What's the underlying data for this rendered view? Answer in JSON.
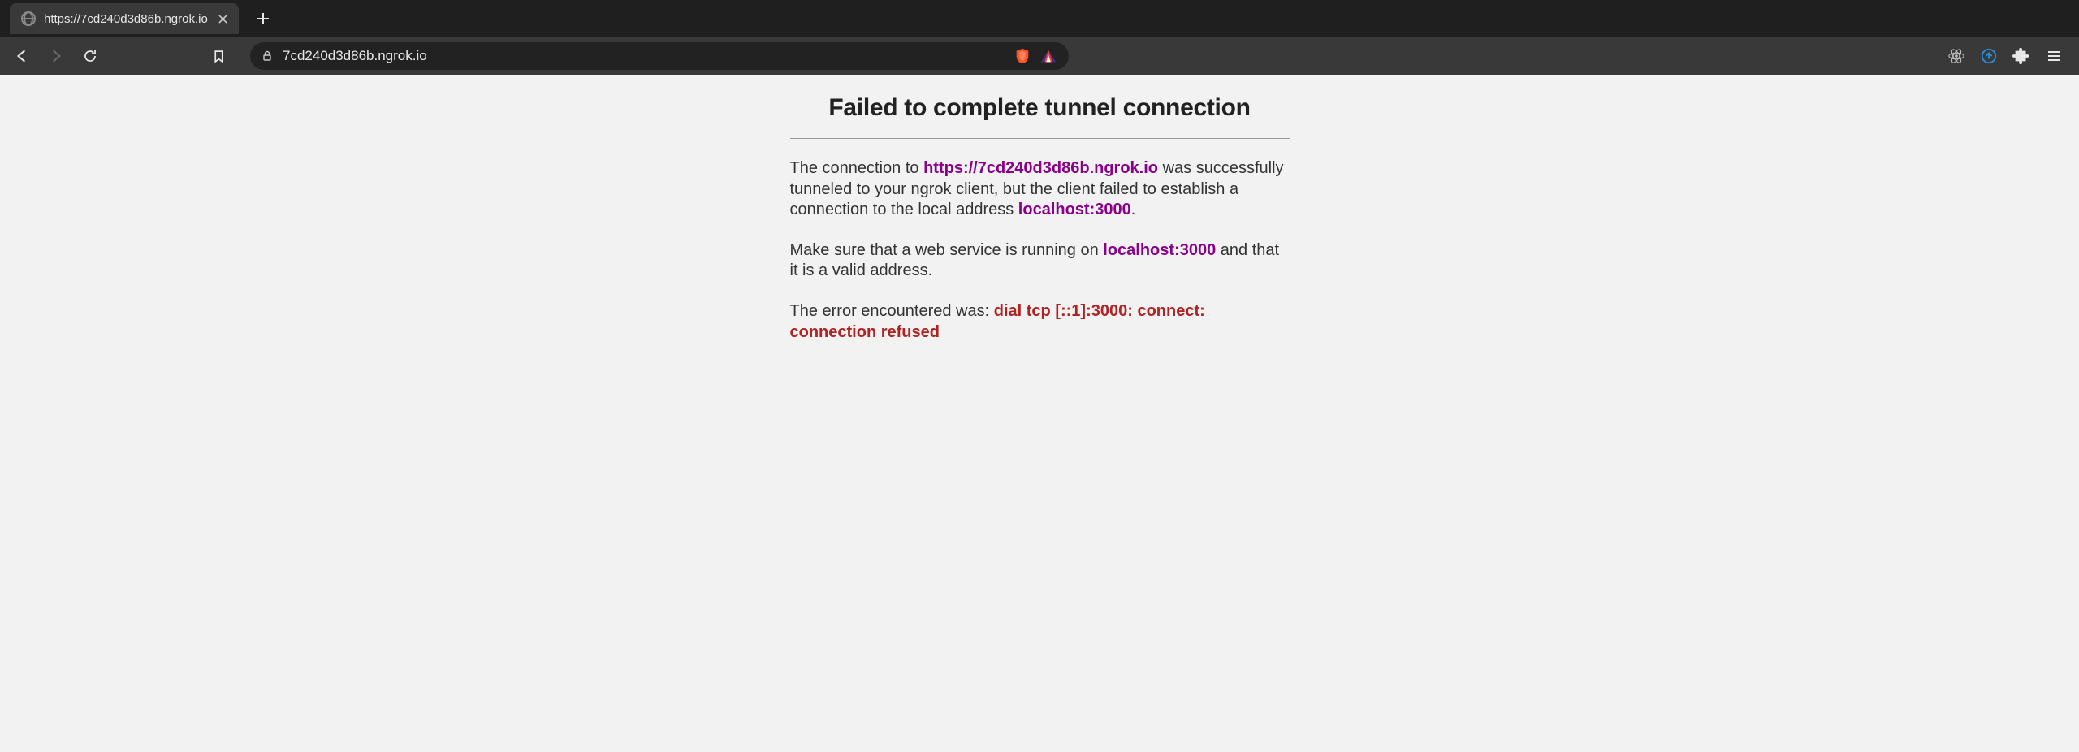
{
  "browser": {
    "tab": {
      "title": "https://7cd240d3d86b.ngrok.io"
    },
    "address_bar": {
      "url": "7cd240d3d86b.ngrok.io"
    }
  },
  "page": {
    "title": "Failed to complete tunnel connection",
    "paragraph1": {
      "prefix": "The connection to ",
      "url": "https://7cd240d3d86b.ngrok.io",
      "middle": " was successfully tunneled to your ngrok client, but the client failed to establish a connection to the local address ",
      "local": "localhost:3000",
      "suffix": "."
    },
    "paragraph2": {
      "prefix": "Make sure that a web service is running on ",
      "local": "localhost:3000",
      "suffix": " and that it is a valid address."
    },
    "paragraph3": {
      "prefix": "The error encountered was: ",
      "error": "dial tcp [::1]:3000: connect: connection refused"
    }
  }
}
